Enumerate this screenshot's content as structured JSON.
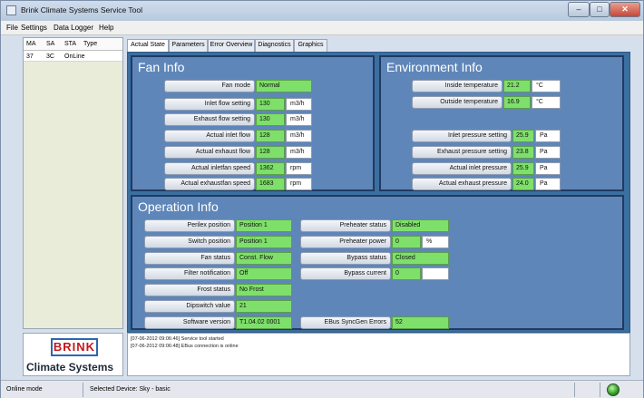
{
  "window": {
    "title": "Brink Climate Systems Service Tool",
    "min": "–",
    "max": "□",
    "close": "✕"
  },
  "menu": [
    "File",
    "Settings",
    "Data Logger",
    "Help"
  ],
  "devices": {
    "headers": [
      "MA",
      "SA",
      "STA",
      "Type"
    ],
    "rows": [
      [
        "37",
        "3C",
        "OnLine",
        ""
      ]
    ]
  },
  "tabs": [
    "Actual State",
    "Parameters",
    "Error Overview",
    "Diagnostics",
    "Graphics"
  ],
  "fan_info": {
    "title": "Fan Info",
    "rows": [
      {
        "label": "Fan mode",
        "value": "Normal",
        "unit": ""
      },
      {
        "label": "Inlet flow setting",
        "value": "130",
        "unit": "m3/h"
      },
      {
        "label": "Exhaust flow setting",
        "value": "130",
        "unit": "m3/h"
      },
      {
        "label": "Actual inlet flow",
        "value": "128",
        "unit": "m3/h"
      },
      {
        "label": "Actual exhaust flow",
        "value": "128",
        "unit": "m3/h"
      },
      {
        "label": "Actual inletfan speed",
        "value": "1362",
        "unit": "rpm"
      },
      {
        "label": "Actual exhaustfan speed",
        "value": "1683",
        "unit": "rpm"
      }
    ]
  },
  "environment_info": {
    "title": "Environment Info",
    "rows": [
      {
        "label": "Inside temperature",
        "value": "21.2",
        "unit": "°C"
      },
      {
        "label": "Outside temperature",
        "value": "16.9",
        "unit": "°C"
      },
      {
        "label": "Inlet pressure setting",
        "value": "25.9",
        "unit": "Pa"
      },
      {
        "label": "Exhaust pressure setting",
        "value": "23.8",
        "unit": "Pa"
      },
      {
        "label": "Actual inlet pressure",
        "value": "25.9",
        "unit": "Pa"
      },
      {
        "label": "Actual exhaust pressure",
        "value": "24.0",
        "unit": "Pa"
      }
    ]
  },
  "operation_info": {
    "title": "Operation Info",
    "left": [
      {
        "label": "Perilex position",
        "value": "Position 1"
      },
      {
        "label": "Switch position",
        "value": "Position 1"
      },
      {
        "label": "Fan status",
        "value": "Const. Flow"
      },
      {
        "label": "Filter notification",
        "value": "Off"
      },
      {
        "label": "Frost status",
        "value": "No Frost"
      },
      {
        "label": "Dipswitch value",
        "value": "21"
      },
      {
        "label": "Software version",
        "value": "T1.04.02 0001"
      }
    ],
    "right": [
      {
        "label": "Preheater status",
        "value": "Disabled",
        "unit": ""
      },
      {
        "label": "Preheater power",
        "value": "0",
        "unit": "%"
      },
      {
        "label": "Bypass status",
        "value": "Closed",
        "unit": ""
      },
      {
        "label": "Bypass current",
        "value": "0",
        "unit": ""
      },
      {
        "label": "EBus SyncGen Errors",
        "value": "52",
        "unit": ""
      }
    ]
  },
  "log": [
    "[07-06-2012 09:06:46]  Service tool started",
    "[07-06-2012 09:06:48]  EBus connection is online"
  ],
  "logo": {
    "brand": "BRINK",
    "tagline": "Climate Systems"
  },
  "status": {
    "mode": "Online mode",
    "device": "Selected Device:  Sky - basic"
  }
}
